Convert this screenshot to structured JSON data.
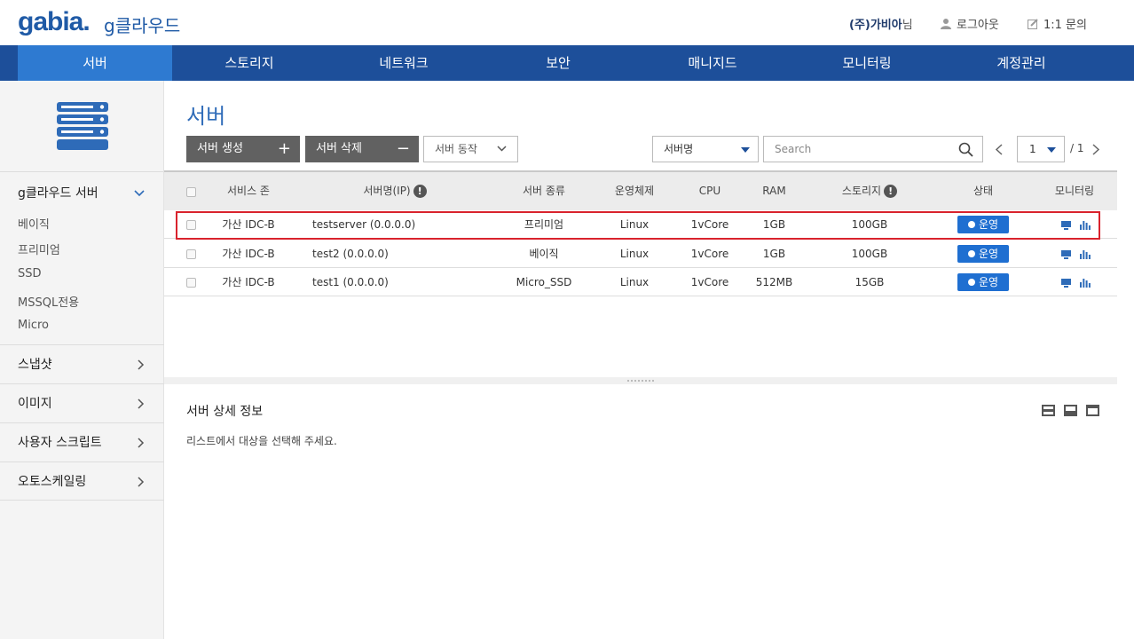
{
  "header": {
    "logo": "gabia.",
    "product": "g클라우드",
    "company": "(주)가비아",
    "company_suffix": "님",
    "logout": "로그아웃",
    "inquiry": "1:1 문의"
  },
  "nav": {
    "items": [
      "서버",
      "스토리지",
      "네트워크",
      "보안",
      "매니지드",
      "모니터링",
      "계정관리"
    ],
    "active": "서버"
  },
  "sidebar": {
    "group_title": "g클라우드 서버",
    "sub_items": [
      "베이직",
      "프리미엄",
      "SSD",
      "MSSQL전용",
      "Micro"
    ],
    "sections": [
      "스냅샷",
      "이미지",
      "사용자 스크립트",
      "오토스케일링"
    ]
  },
  "main": {
    "title": "서버",
    "create_button": "서버 생성",
    "delete_button": "서버 삭제",
    "action_select": "서버 동작",
    "filter_select": "서버명",
    "search_placeholder": "Search",
    "page_current": "1",
    "page_total": "/ 1"
  },
  "table": {
    "columns": [
      "서비스 존",
      "서버명(IP)",
      "서버 종류",
      "운영체제",
      "CPU",
      "RAM",
      "스토리지",
      "상태",
      "모니터링"
    ],
    "rows": [
      {
        "zone": "가산 IDC-B",
        "name": "testserver (0.0.0.0)",
        "type": "프리미엄",
        "os": "Linux",
        "cpu": "1vCore",
        "ram": "1GB",
        "storage": "100GB",
        "status": "운영"
      },
      {
        "zone": "가산 IDC-B",
        "name": "test2 (0.0.0.0)",
        "type": "베이직",
        "os": "Linux",
        "cpu": "1vCore",
        "ram": "1GB",
        "storage": "100GB",
        "status": "운영"
      },
      {
        "zone": "가산 IDC-B",
        "name": "test1 (0.0.0.0)",
        "type": "Micro_SSD",
        "os": "Linux",
        "cpu": "1vCore",
        "ram": "512MB",
        "storage": "15GB",
        "status": "운영"
      }
    ]
  },
  "detail": {
    "title": "서버 상세 정보",
    "message": "리스트에서 대상을 선택해 주세요."
  },
  "colors": {
    "nav_bg": "#1d4f9a",
    "nav_active": "#2e7ad1",
    "status_badge": "#1f6fd1",
    "highlight": "#d9232d"
  }
}
